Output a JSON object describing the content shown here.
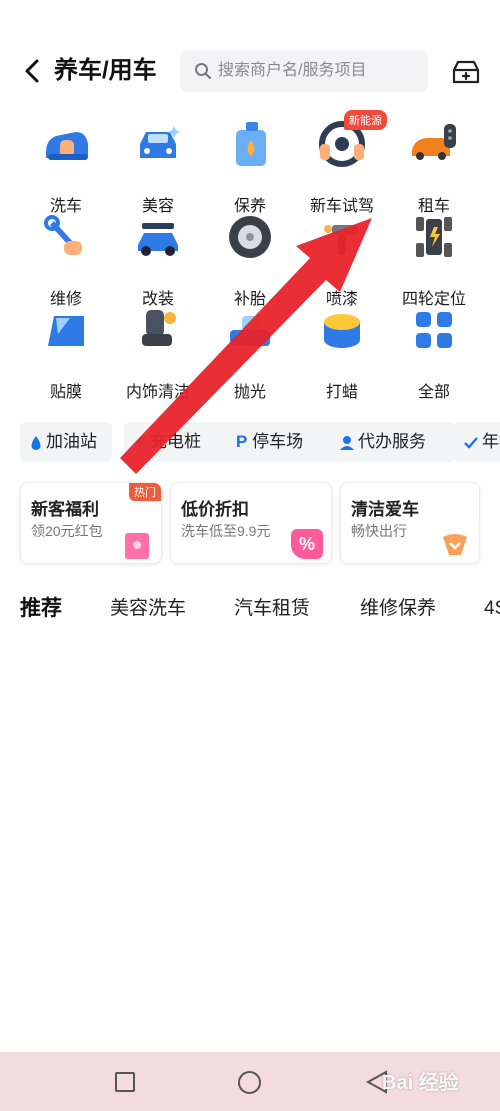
{
  "header": {
    "title": "养车/用车",
    "search_placeholder": "搜索商户名/服务项目"
  },
  "services": [
    {
      "label": "洗车",
      "icon": "car-wash-icon"
    },
    {
      "label": "美容",
      "icon": "car-beauty-icon"
    },
    {
      "label": "保养",
      "icon": "oil-can-icon"
    },
    {
      "label": "新车试驾",
      "icon": "steering-wheel-icon",
      "badge": "新能源"
    },
    {
      "label": "租车",
      "icon": "car-key-icon"
    },
    {
      "label": "维修",
      "icon": "wrench-icon"
    },
    {
      "label": "改装",
      "icon": "modified-car-icon"
    },
    {
      "label": "补胎",
      "icon": "tire-icon"
    },
    {
      "label": "喷漆",
      "icon": "spray-gun-icon"
    },
    {
      "label": "四轮定位",
      "icon": "wheel-alignment-icon"
    },
    {
      "label": "贴膜",
      "icon": "window-film-icon"
    },
    {
      "label": "内饰清洁",
      "icon": "car-seat-icon"
    },
    {
      "label": "抛光",
      "icon": "polish-icon"
    },
    {
      "label": "打蜡",
      "icon": "wax-icon"
    },
    {
      "label": "全部",
      "icon": "grid-all-icon"
    }
  ],
  "chips": [
    {
      "label": "加油站",
      "icon": "fuel-drop-icon"
    },
    {
      "label": "充电桩",
      "icon": "charging-icon"
    },
    {
      "label": "停车场",
      "icon": "parking-icon",
      "glyph": "P"
    },
    {
      "label": "代办服务",
      "icon": "person-icon"
    },
    {
      "label": "年检",
      "icon": "check-icon"
    }
  ],
  "promos": [
    {
      "title": "新客福利",
      "subtitle": "领20元红包",
      "tag": "热门",
      "icon": "red-envelope-icon"
    },
    {
      "title": "低价折扣",
      "subtitle": "洗车低至9.9元",
      "icon": "discount-tag-icon",
      "glyph": "%"
    },
    {
      "title": "清洁爱车",
      "subtitle": "畅快出行",
      "icon": "coupon-icon"
    }
  ],
  "tabs": [
    "推荐",
    "美容洗车",
    "汽车租赁",
    "维修保养",
    "4S"
  ],
  "watermark": "Bai 经验",
  "colors": {
    "accent_blue": "#1a73e8",
    "tab_highlight": "#ffd54a",
    "badge_red": "#f04a3c",
    "arrow_red": "#e8232a",
    "nav_bar": "#f3dbe0"
  }
}
